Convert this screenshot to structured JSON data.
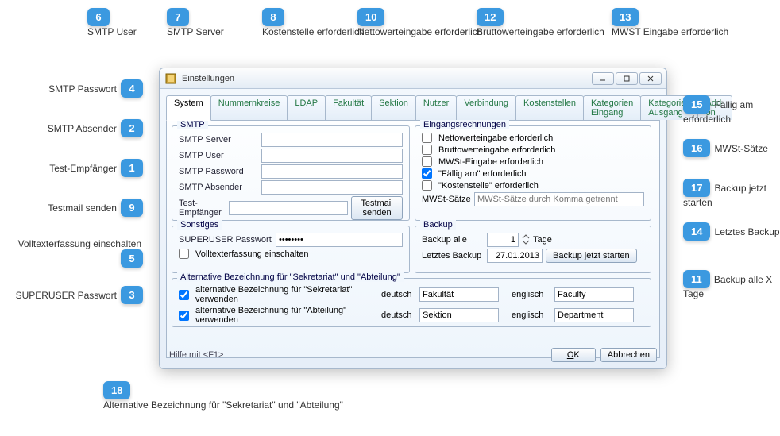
{
  "window": {
    "title": "Einstellungen"
  },
  "tabs": [
    "System",
    "Nummernkreise",
    "LDAP",
    "Fakultät",
    "Sektion",
    "Nutzer",
    "Verbindung",
    "Kostenstellen",
    "Kategorien Eingang",
    "Kategorien Ausgang",
    "Add-on"
  ],
  "smtp": {
    "legend": "SMTP",
    "server_label": "SMTP Server",
    "user_label": "SMTP User",
    "password_label": "SMTP Password",
    "absender_label": "SMTP Absender",
    "test_empf_label": "Test-Empfänger",
    "testmail_btn": "Testmail senden"
  },
  "eingang": {
    "legend": "Eingangsrechnungen",
    "netto": "Nettowerteingabe erforderlich",
    "brutto": "Bruttowerteingabe erforderlich",
    "mwst": "MWSt-Eingabe erforderlich",
    "faellig": "\"Fällig am\" erforderlich",
    "kostenstelle": "\"Kostenstelle\" erforderlich",
    "mwst_saetze_label": "MWSt-Sätze",
    "mwst_saetze_placeholder": "MWSt-Sätze durch Komma getrennt"
  },
  "sonstiges": {
    "legend": "Sonstiges",
    "superuser_label": "SUPERUSER Passwort",
    "superuser_value": "••••••••",
    "volltext": "Volltexterfassung einschalten"
  },
  "backup": {
    "legend": "Backup",
    "alle_label": "Backup alle",
    "alle_value": "1",
    "tage": "Tage",
    "letztes_label": "Letztes Backup",
    "letztes_value": "27.01.2013",
    "start_btn": "Backup jetzt starten"
  },
  "altbez": {
    "legend": "Alternative Bezeichnung für \"Sekretariat\" und \"Abteilung\"",
    "sek_check": "alternative Bezeichnung für \"Sekretariat\" verwenden",
    "abt_check": "alternative Bezeichnung für \"Abteilung\" verwenden",
    "deutsch": "deutsch",
    "englisch": "englisch",
    "sek_de": "Fakultät",
    "sek_en": "Faculty",
    "abt_de": "Sektion",
    "abt_en": "Department"
  },
  "footer": {
    "hint": "Hilfe mit <F1>",
    "ok": "OK",
    "cancel": "Abbrechen"
  },
  "callouts": {
    "1": "Test-Empfänger",
    "2": "SMTP Absender",
    "3": "SUPERUSER Passwort",
    "4": "SMTP Passwort",
    "5": "Volltexterfassung einschalten",
    "6": "SMTP User",
    "7": "SMTP Server",
    "8": "Kostenstelle erforderlich",
    "9": "Testmail senden",
    "10": "Nettowerteingabe erforderlich",
    "11": "Backup alle X Tage",
    "12": "Bruttowerteingabe erforderlich",
    "13": "MWST Eingabe erforderlich",
    "14": "Letztes Backup",
    "15": "Fällig am erforderlich",
    "16": "MWSt-Sätze",
    "17": "Backup jetzt starten",
    "18": "Alternative Bezeichnung für \"Sekretariat\" und \"Abteilung\""
  }
}
